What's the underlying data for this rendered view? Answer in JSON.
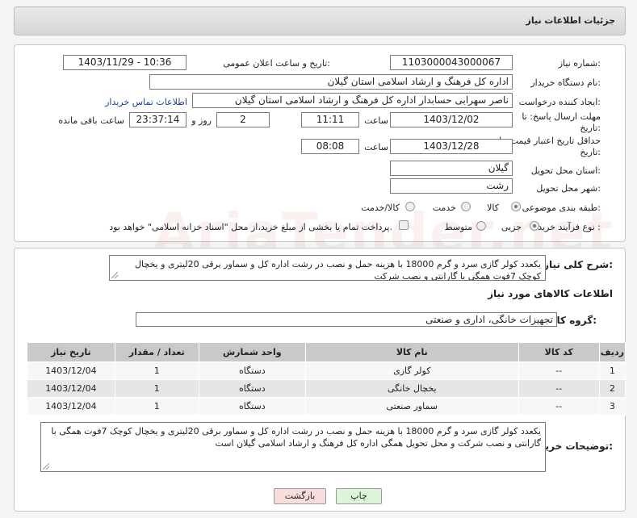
{
  "header": {
    "title": "جزئیات اطلاعات نیاز"
  },
  "form": {
    "need_number_label": "شماره نیاز:",
    "need_number": "1103000043000067",
    "announce_label": "تاریخ و ساعت اعلان عمومی:",
    "announce_value": "1403/11/29 - 10:36",
    "buyer_org_label": "نام دستگاه خریدار:",
    "buyer_org": "اداره کل فرهنگ و ارشاد اسلامی استان گیلان",
    "creator_label": "ایجاد کننده درخواست:",
    "creator": "ناصر سهرابی حسابدار اداره کل فرهنگ و ارشاد اسلامی استان گیلان",
    "contact_link": "اطلاعات تماس خریدار",
    "deadline_label_1": "مهلت ارسال پاسخ: تا",
    "deadline_label_2": "تاریخ:",
    "deadline_date": "1403/12/02",
    "time_label": "ساعت",
    "deadline_time": "11:11",
    "days_value": "2",
    "days_label": "روز و",
    "remaining_time": "23:37:14",
    "remaining_label": "ساعت باقی مانده",
    "validity_label_1": "حداقل تاریخ اعتبار قیمت: تا",
    "validity_label_2": "تاریخ:",
    "validity_date": "1403/12/28",
    "validity_time_label": "ساعت",
    "validity_time": "08:08",
    "province_label": "استان محل تحویل:",
    "province": "گیلان",
    "city_label": "شهر محل تحویل:",
    "city": "رشت",
    "category_label": "طبقه بندی موضوعی:",
    "category_options": [
      "کالا",
      "خدمت",
      "کالا/خدمت"
    ],
    "process_label": "نوع فرآیند خرید :",
    "process_options": [
      "جزیی",
      "متوسط"
    ],
    "payment_note": "پرداخت تمام یا بخشی از مبلغ خرید،از محل \"اسناد خزانه اسلامی\" خواهد بود."
  },
  "summary": {
    "label": "شرح کلی نیاز:",
    "text": "یکعدد کولر گازی سرد و گرم 18000 با هزینه حمل و نصب در رشت اداره کل و سماور برقی 20لیتری و یخچال کوچک 7فوت همگی با گارانتی و نصب شرکت"
  },
  "goods": {
    "section_title": "اطلاعات کالاهای مورد نیاز",
    "group_label": "گروه کالا:",
    "group_value": "تجهیزات خانگی، اداری و صنعتی",
    "columns": [
      "ردیف",
      "کد کالا",
      "نام کالا",
      "واحد شمارش",
      "تعداد / مقدار",
      "تاریخ نیاز"
    ],
    "rows": [
      {
        "row": "1",
        "code": "--",
        "name": "کولر گازی",
        "unit": "دستگاه",
        "qty": "1",
        "date": "1403/12/04"
      },
      {
        "row": "2",
        "code": "--",
        "name": "یخچال خانگی",
        "unit": "دستگاه",
        "qty": "1",
        "date": "1403/12/04"
      },
      {
        "row": "3",
        "code": "--",
        "name": "سماور صنعتی",
        "unit": "دستگاه",
        "qty": "1",
        "date": "1403/12/04"
      }
    ]
  },
  "buyer_notes": {
    "label": "توضیحات خریدار:",
    "text": "یکعدد کولر گازی سرد و گرم 18000 با هزینه حمل و نصب در رشت اداره کل و سماور برقی 20لیتری و یخچال کوچک 7فوت همگی با گارانتی و نصب شرکت و محل تحویل همگی اداره کل فرهنگ و ارشاد اسلامی گیلان است"
  },
  "buttons": {
    "back": "بازگشت",
    "print": "چاپ"
  },
  "colors": {
    "back_bg": "#f9dcdc",
    "print_bg": "#dcf5d8",
    "link": "#1a3f9e"
  },
  "watermark": "AriaTender.net"
}
